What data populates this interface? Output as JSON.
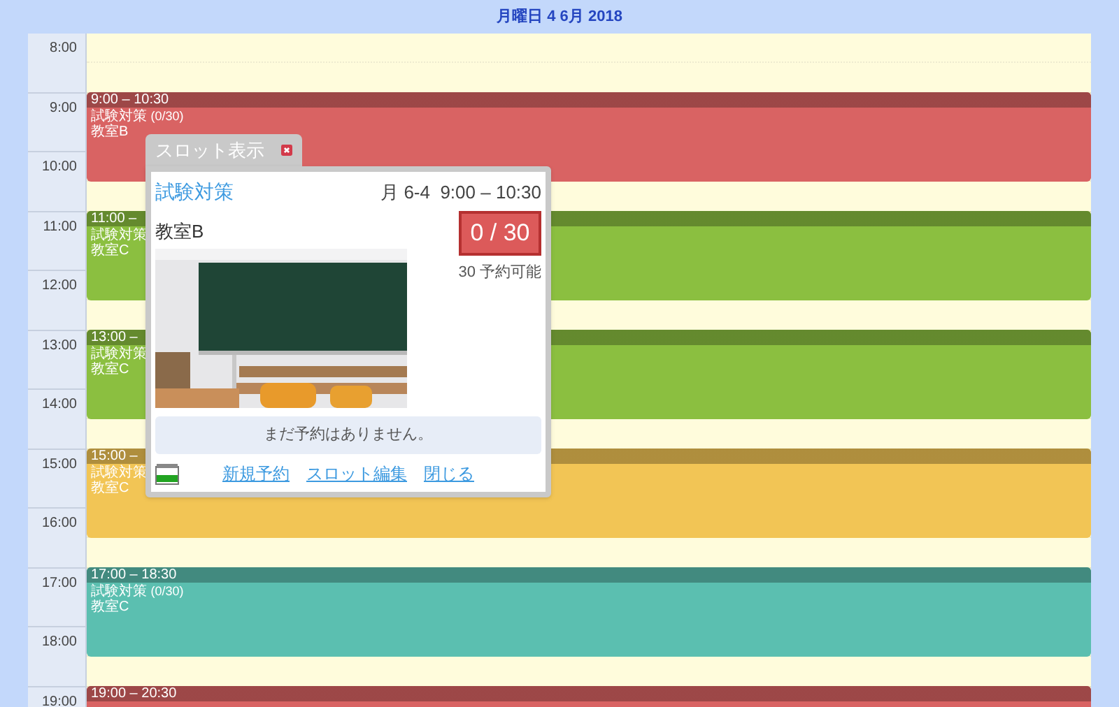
{
  "header": {
    "title": "月曜日 4 6月 2018"
  },
  "hours": [
    "8:00",
    "9:00",
    "10:00",
    "11:00",
    "12:00",
    "13:00",
    "14:00",
    "15:00",
    "16:00",
    "17:00",
    "18:00",
    "19:00"
  ],
  "events": [
    {
      "time": "9:00 – 10:30",
      "title": "試験対策",
      "count": "(0/30)",
      "room": "教室B",
      "color": "#d96363"
    },
    {
      "time": "11:00 –",
      "title": "試験対策",
      "room": "教室C",
      "color": "#8bbf40"
    },
    {
      "time": "13:00 –",
      "title": "試験対策",
      "room": "教室C",
      "color": "#8bbf40"
    },
    {
      "time": "15:00 –",
      "title": "試験対策",
      "room": "教室C",
      "color": "#f2c555"
    },
    {
      "time": "17:00 – 18:30",
      "title": "試験対策",
      "count": "(0/30)",
      "room": "教室C",
      "color": "#5bbfb0"
    },
    {
      "time": "19:00 – 20:30",
      "color": "#d96363"
    }
  ],
  "popup": {
    "tab": "スロット表示",
    "title": "試験対策",
    "when": "月 6-4  9:00 – 10:30",
    "room": "教室B",
    "capacity": "0 / 30",
    "available": "30 予約可能",
    "message": "まだ予約はありません。",
    "links": [
      "新規予約",
      "スロット編集",
      "閉じる"
    ]
  }
}
